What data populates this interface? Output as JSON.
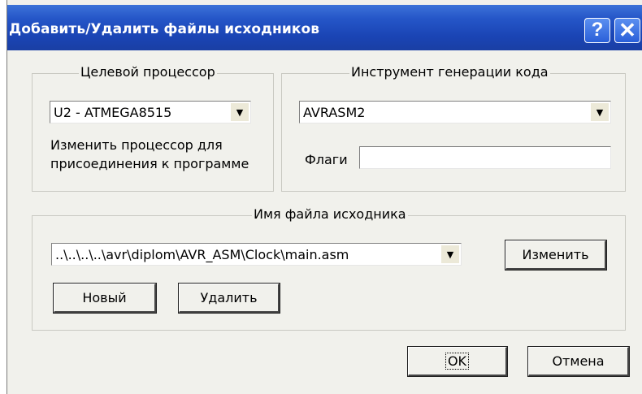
{
  "window": {
    "title": "Добавить/Удалить файлы исходников",
    "help_glyph": "?",
    "close_glyph": "✕"
  },
  "processor_group": {
    "legend": "Целевой процессор",
    "selected": "U2 - ATMEGA8515",
    "hint_line1": "Изменить процессор для",
    "hint_line2": "присоединения к программе"
  },
  "codegen_group": {
    "legend": "Инструмент генерации кода",
    "selected": "AVRASM2",
    "flags_label": "Флаги",
    "flags_value": ""
  },
  "source_group": {
    "legend": "Имя файла исходника",
    "selected": "..\\..\\..\\..\\avr\\diplom\\AVR_ASM\\Clock\\main.asm",
    "change_label": "Изменить",
    "new_label": "Новый",
    "delete_label": "Удалить"
  },
  "footer": {
    "ok_label": "OK",
    "cancel_label": "Отмена"
  },
  "icons": {
    "dropdown": "▼"
  }
}
